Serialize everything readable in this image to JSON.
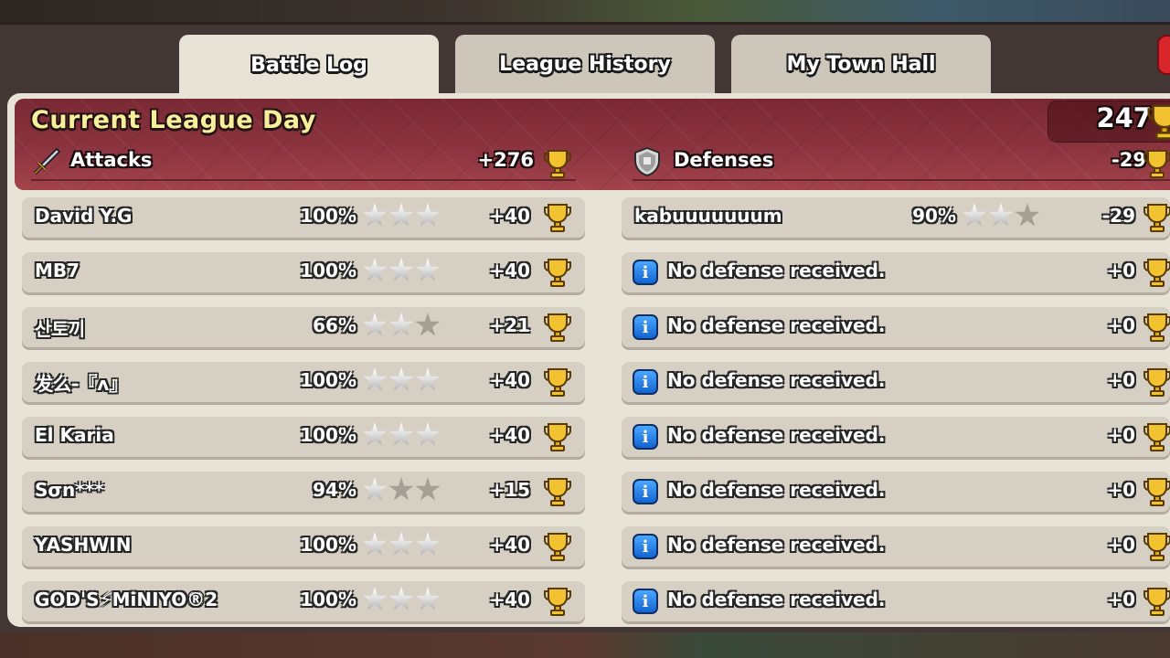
{
  "tabs": [
    {
      "label": "Battle Log",
      "active": true
    },
    {
      "label": "League History",
      "active": false
    },
    {
      "label": "My Town Hall",
      "active": false
    }
  ],
  "header": {
    "title": "Current League Day",
    "total_trophies": "247"
  },
  "attacks": {
    "label": "Attacks",
    "icon": "sword-icon",
    "total": "+276",
    "rows": [
      {
        "name": "David Y.G",
        "percent": "100%",
        "stars": 3,
        "trophies": "+40"
      },
      {
        "name": "MB7",
        "percent": "100%",
        "stars": 3,
        "trophies": "+40"
      },
      {
        "name": "산토끼",
        "percent": "66%",
        "stars": 2,
        "trophies": "+21"
      },
      {
        "name": "发么-『ʌ』",
        "percent": "100%",
        "stars": 3,
        "trophies": "+40"
      },
      {
        "name": "El Karia",
        "percent": "100%",
        "stars": 3,
        "trophies": "+40"
      },
      {
        "name": "Sσn***",
        "percent": "94%",
        "stars": 1,
        "trophies": "+15"
      },
      {
        "name": "YASHWIN",
        "percent": "100%",
        "stars": 3,
        "trophies": "+40"
      },
      {
        "name": "GOD'S⚡MiNIYO®2",
        "percent": "100%",
        "stars": 3,
        "trophies": "+40"
      }
    ]
  },
  "defenses": {
    "label": "Defenses",
    "icon": "shield-icon",
    "total": "-29",
    "first": {
      "name": "kabuuuuuuum",
      "percent": "90%",
      "stars": 2,
      "trophies": "-29"
    },
    "empty_text": "No defense received.",
    "empty_trophies": "+0",
    "empty_count": 7
  },
  "colors": {
    "header_red": "#8c3440",
    "title_yellow": "#f8ef9a",
    "row_bg": "#d5cfc4",
    "info_blue": "#1464cf",
    "trophy_gold": "#f2c230"
  }
}
